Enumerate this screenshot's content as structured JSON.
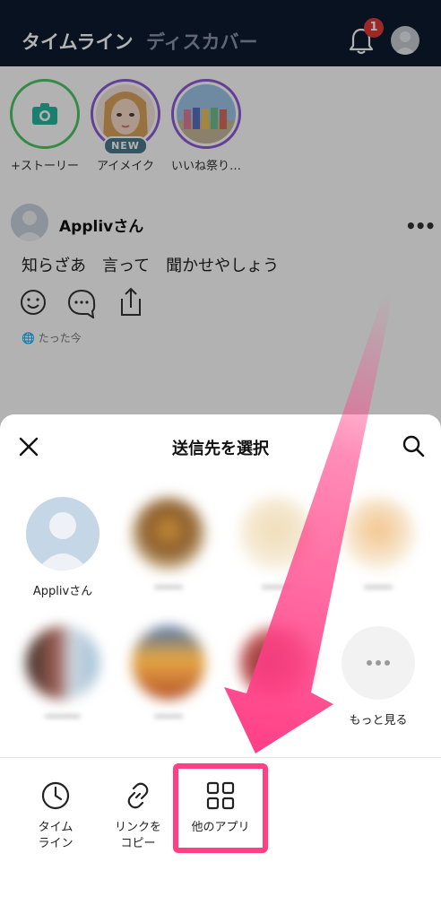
{
  "header": {
    "tab_timeline": "タイムライン",
    "tab_discover": "ディスカバー",
    "notification_count": "1"
  },
  "stories": [
    {
      "label": "+ストーリー"
    },
    {
      "label": "アイメイク",
      "badge": "NEW"
    },
    {
      "label": "いいね祭り…"
    }
  ],
  "post": {
    "author": "Applivさん",
    "text": "知らざあ　言って　聞かせやしょう",
    "time": "たった今"
  },
  "share_sheet": {
    "title": "送信先を選択",
    "contacts": [
      {
        "label": "Applivさん"
      },
      {
        "label": "もっと見る"
      }
    ],
    "actions": [
      {
        "label": "タイム\nライン"
      },
      {
        "label": "リンクを\nコピー"
      },
      {
        "label": "他のアプリ"
      }
    ]
  },
  "colors": {
    "header_bg": "#0d1a2f",
    "story_ring_green": "#4cc764",
    "story_ring_purple": "#8e5bd6",
    "badge_red": "#e03a3a",
    "highlight_pink": "#ff3f86"
  }
}
